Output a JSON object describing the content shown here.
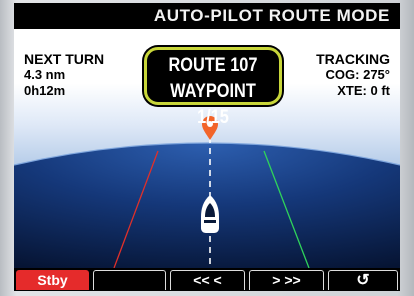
{
  "header": {
    "title": "AUTO-PILOT ROUTE MODE"
  },
  "next_turn": {
    "heading": "NEXT TURN",
    "distance": "4.3 nm",
    "time": "0h12m"
  },
  "route": {
    "line1": "ROUTE 107",
    "line2": "WAYPOINT 1/15"
  },
  "tracking": {
    "heading": "TRACKING",
    "cog": "COG: 275°",
    "xte": "XTE: 0 ft"
  },
  "softkeys": {
    "key1": "Stby",
    "key2": "",
    "key3": "<<  <",
    "key4": ">  >>",
    "key5": "↺"
  },
  "icons": {
    "waypoint": "waypoint-pin-icon",
    "vessel": "boat-icon",
    "return": "return-arrow-icon"
  },
  "colors": {
    "frame_accent": "#c8d63a",
    "standby": "#e52b2b",
    "port_line": "#e0302a",
    "starboard_line": "#2fd35a"
  }
}
